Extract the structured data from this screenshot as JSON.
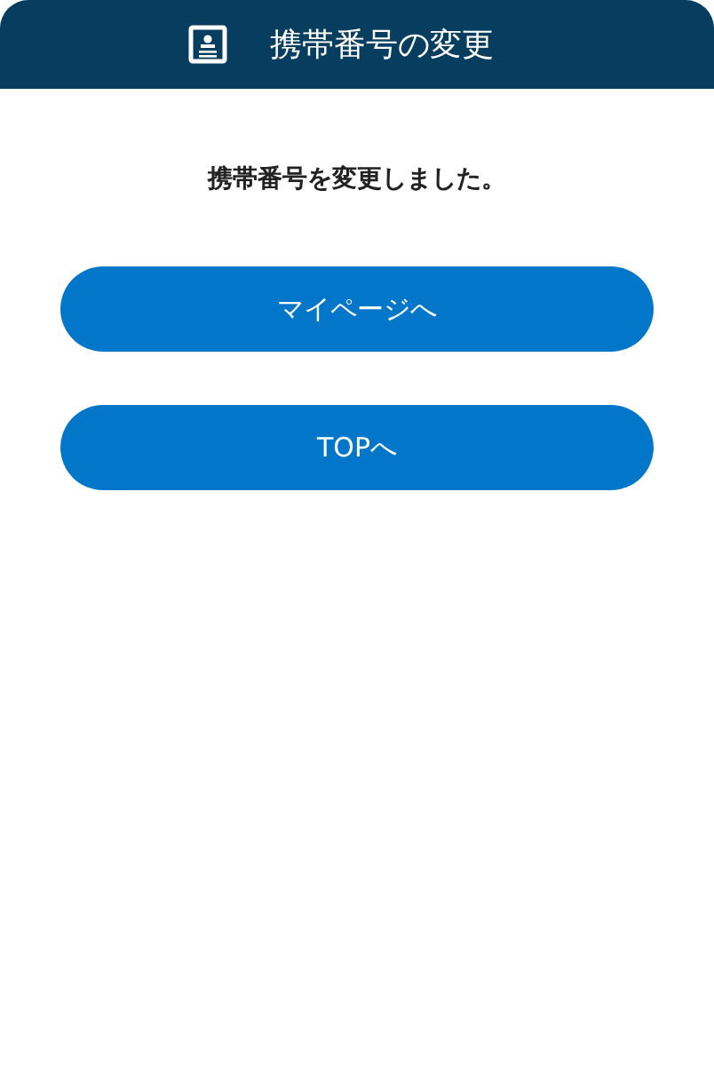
{
  "header": {
    "title": "携帯番号の変更"
  },
  "message": "携帯番号を変更しました。",
  "buttons": [
    "マイページへ",
    "TOPへ"
  ]
}
